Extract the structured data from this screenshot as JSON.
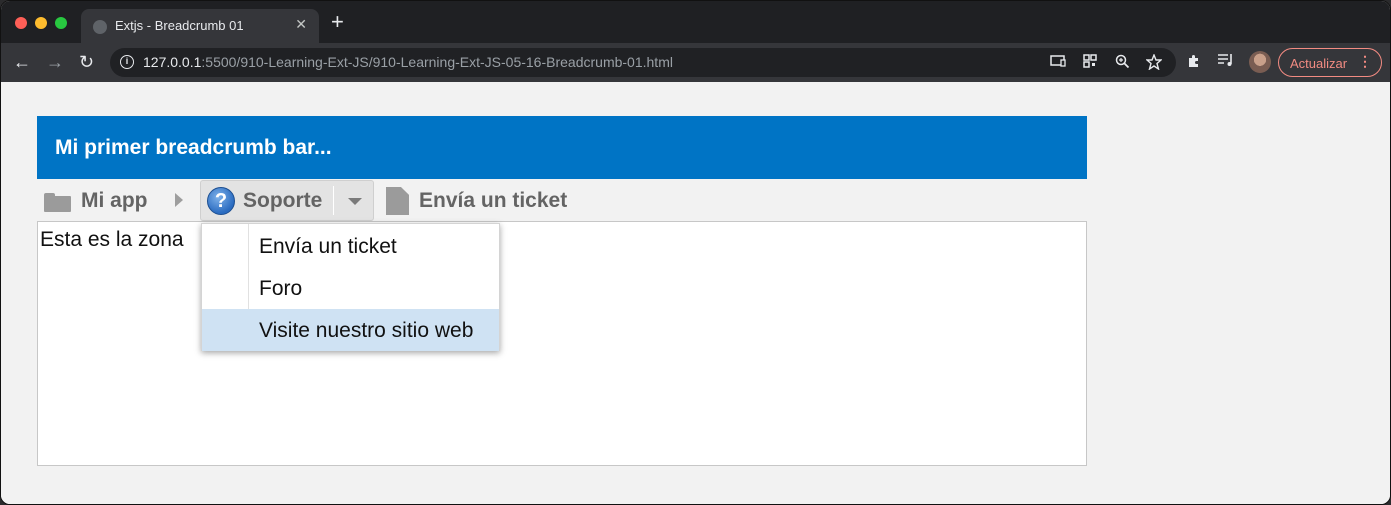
{
  "browser": {
    "tab_title": "Extjs - Breadcrumb 01",
    "tab_close": "✕",
    "new_tab": "+",
    "nav": {
      "back": "←",
      "forward": "→",
      "reload": "↻"
    },
    "url_host": "127.0.0.1",
    "url_path": ":5500/910-Learning-Ext-JS/910-Learning-Ext-JS-05-16-Breadcrumb-01.html",
    "update_button": "Actualizar",
    "update_menu": "⋮"
  },
  "panel": {
    "title": "Mi primer breadcrumb bar..."
  },
  "breadcrumb": {
    "root": "Mi app",
    "current": "Soporte",
    "help_glyph": "?",
    "last": "Envía un ticket"
  },
  "content": {
    "text": "Esta es la zona "
  },
  "menu": {
    "items": [
      {
        "label": "Envía un ticket"
      },
      {
        "label": "Foro"
      },
      {
        "label": "Visite nuestro sitio web",
        "highlighted": true
      }
    ]
  },
  "colors": {
    "header_bg": "#0074c5",
    "highlight": "#cfe2f3",
    "breadcrumb_text": "#646464"
  }
}
